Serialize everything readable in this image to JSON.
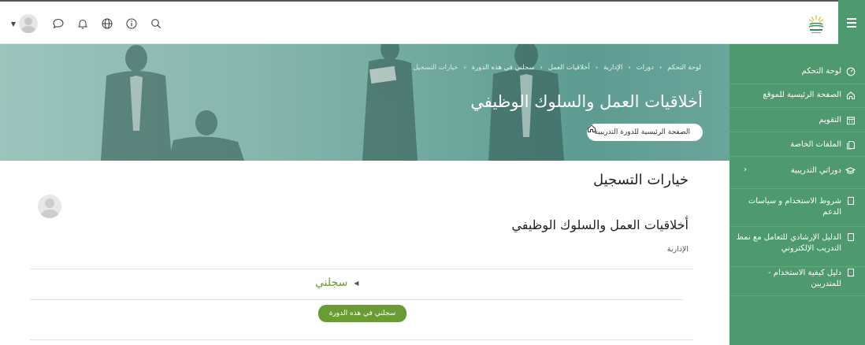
{
  "colors": {
    "primary": "#4e9a6e",
    "button": "#6a9b35",
    "link_green": "#6d9a3a"
  },
  "topbar": {
    "icons": [
      "caret-down-icon",
      "avatar",
      "message-icon",
      "bell-icon",
      "globe-icon",
      "info-icon",
      "search-icon"
    ]
  },
  "sidebar": {
    "items": [
      {
        "label": "لوحة التحكم",
        "icon": "dashboard-icon"
      },
      {
        "label": "الصفحة الرئيسية للموقع",
        "icon": "home-icon"
      },
      {
        "label": "التقويم",
        "icon": "calendar-icon"
      },
      {
        "label": "الملفات الخاصة",
        "icon": "files-icon"
      },
      {
        "label": "دوراتي التدريبية",
        "icon": "graduation-cap-icon",
        "chevron": "›"
      },
      {
        "label": "شروط الاستخدام و سياسات الدعم",
        "icon": "page-icon"
      },
      {
        "label": "الدليل الإرشادي للتعامل مع نمط التدريب الإلكتروني",
        "icon": "page-icon"
      },
      {
        "label": "دليل كيفية الاستخدام - للمتدربين",
        "icon": "page-icon"
      }
    ]
  },
  "breadcrumb": {
    "items": [
      "لوحة التحكم",
      "دورات",
      "الإدارية",
      "أخلاقيات العمل",
      "سجلني في هذه الدورة",
      "خيارات التسجيل"
    ]
  },
  "banner": {
    "title": "أخلاقيات العمل والسلوك الوظيفي",
    "home_button": "الصفحة الرئيسية للدورة التدريبية"
  },
  "main": {
    "heading": "خيارات التسجيل",
    "course_name": "أخلاقيات العمل والسلوك الوظيفي",
    "category": "الإدارية",
    "self_enrol_title": "سجلني",
    "enrol_button": "سجلني في هذه الدورة"
  }
}
